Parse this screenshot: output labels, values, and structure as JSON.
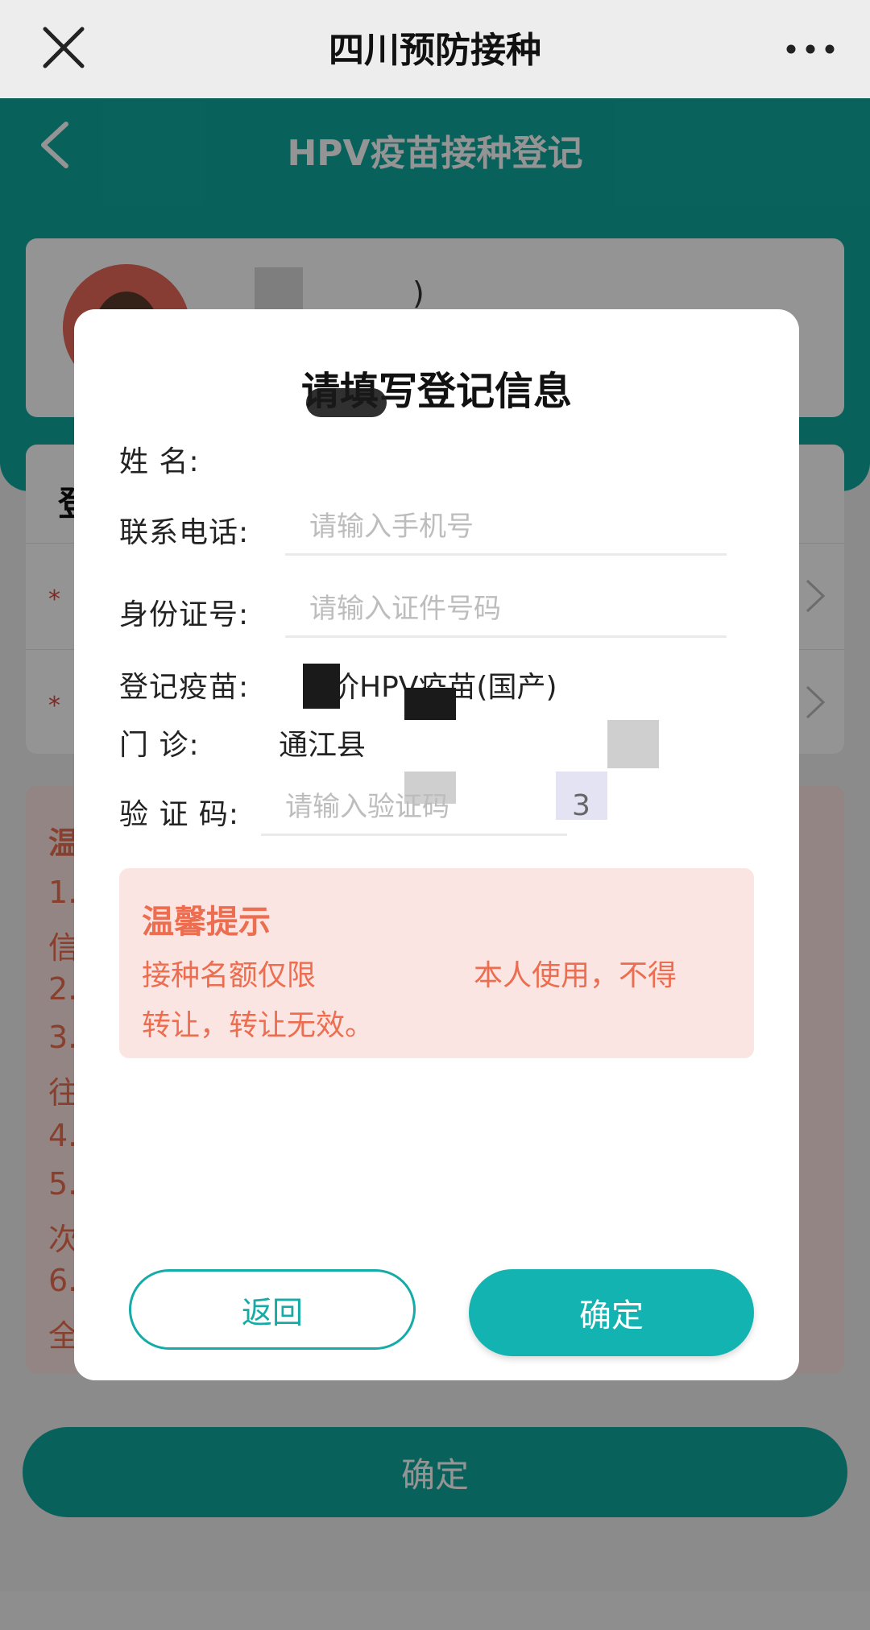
{
  "topbar": {
    "title": "四川预防接种"
  },
  "header": {
    "title": "HPV疫苗接种登记"
  },
  "profile": {
    "paren": ")"
  },
  "form_card": {
    "section_title": "登"
  },
  "tips_card": {
    "lines": [
      "温",
      "1.",
      "信",
      "2.",
      "3.",
      "往",
      "4.",
      "5.",
      "次",
      "6.",
      "全"
    ]
  },
  "bottom_button": {
    "label": "确定"
  },
  "modal": {
    "title": "请填写登记信息",
    "fields": {
      "name_label": "姓    名:",
      "phone_label": "联系电话:",
      "phone_placeholder": "请输入手机号",
      "id_label": "身份证号:",
      "id_placeholder": "请输入证件号码",
      "vaccine_label": "登记疫苗:",
      "vaccine_value": "价HPV疫苗(国产)",
      "clinic_label": "门    诊:",
      "clinic_value": "通江县",
      "captcha_label": "验 证 码:",
      "captcha_placeholder": "请输入验证码",
      "captcha_value": "3"
    },
    "tip": {
      "heading": "温馨提示",
      "line1a": "接种名额仅限",
      "line1b": "本人使用，不得",
      "line2": "转让，转让无效。"
    },
    "buttons": {
      "back": "返回",
      "confirm": "确定"
    }
  },
  "colors": {
    "teal": "#11a89f",
    "tip_text": "#ec6d4f",
    "tip_bg": "#fbe5e2"
  }
}
